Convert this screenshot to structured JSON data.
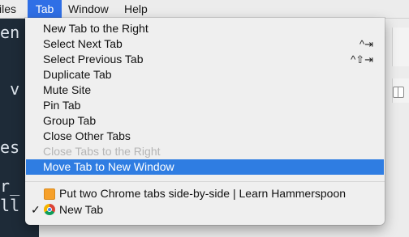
{
  "menubar": {
    "items": [
      "iles",
      "Tab",
      "Window",
      "Help"
    ],
    "active": "Tab"
  },
  "terminal": {
    "lines": [
      " en",
      "s v",
      "res",
      "cr_",
      "all"
    ]
  },
  "tab_menu": {
    "items": [
      {
        "label": "New Tab to the Right",
        "shortcut": ""
      },
      {
        "label": "Select Next Tab",
        "shortcut": "^⇥"
      },
      {
        "label": "Select Previous Tab",
        "shortcut": "^⇧⇥"
      },
      {
        "label": "Duplicate Tab",
        "shortcut": ""
      },
      {
        "label": "Mute Site",
        "shortcut": ""
      },
      {
        "label": "Pin Tab",
        "shortcut": ""
      },
      {
        "label": "Group Tab",
        "shortcut": ""
      },
      {
        "label": "Close Other Tabs",
        "shortcut": ""
      },
      {
        "label": "Close Tabs to the Right",
        "shortcut": "",
        "disabled": true
      },
      {
        "label": "Move Tab to New Window",
        "shortcut": "",
        "highlighted": true
      }
    ],
    "tabs": [
      {
        "label": "Put two Chrome tabs side-by-side | Learn Hammerspoon",
        "icon": "hammerspoon-favicon-icon",
        "checked": false
      },
      {
        "label": "New Tab",
        "icon": "chrome-icon",
        "checked": true
      }
    ],
    "checkmark": "✓"
  },
  "colors": {
    "highlight": "#2f7de2",
    "menubar_active": "#2f6fe6",
    "terminal_bg": "#1e2b38"
  }
}
